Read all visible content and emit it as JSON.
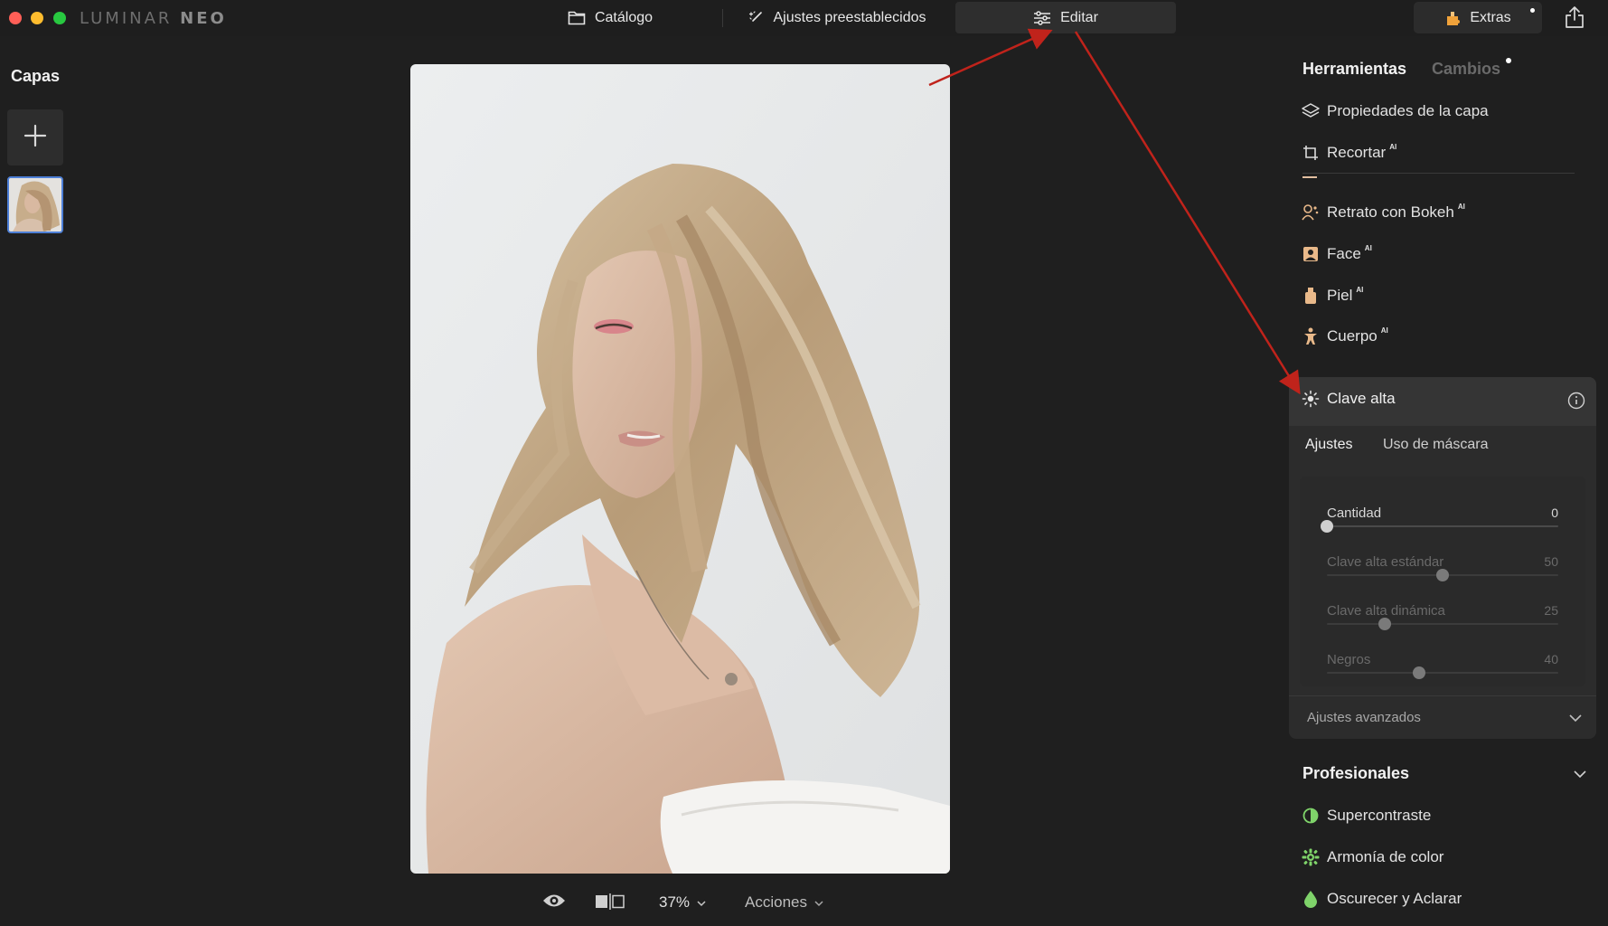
{
  "app": {
    "logo_main": "LUMINAR",
    "logo_sub": "NEO"
  },
  "topnav": {
    "catalog": "Catálogo",
    "presets": "Ajustes preestablecidos",
    "edit": "Editar",
    "extras": "Extras"
  },
  "left_panel": {
    "title": "Capas"
  },
  "bottom_bar": {
    "zoom": "37%",
    "actions": "Acciones"
  },
  "right_panel": {
    "tab_tools": "Herramientas",
    "tab_changes": "Cambios",
    "tools": [
      {
        "label": "Propiedades de la capa",
        "ai": ""
      },
      {
        "label": "Recortar",
        "ai": "AI"
      },
      {
        "label": "Retrato con Bokeh",
        "ai": "AI"
      },
      {
        "label": "Face",
        "ai": "AI"
      },
      {
        "label": "Piel",
        "ai": "AI"
      },
      {
        "label": "Cuerpo",
        "ai": "AI"
      }
    ],
    "card": {
      "title": "Clave alta",
      "tab_settings": "Ajustes",
      "tab_mask": "Uso de máscara",
      "sliders": [
        {
          "label": "Cantidad",
          "value": "0",
          "fraction": 0.0
        },
        {
          "label": "Clave alta estándar",
          "value": "50",
          "fraction": 0.5
        },
        {
          "label": "Clave alta dinámica",
          "value": "25",
          "fraction": 0.25
        },
        {
          "label": "Negros",
          "value": "40",
          "fraction": 0.4
        }
      ],
      "advanced": "Ajustes avanzados"
    },
    "professional": {
      "title": "Profesionales",
      "items": [
        {
          "label": "Supercontraste"
        },
        {
          "label": "Armonía de color"
        },
        {
          "label": "Oscurecer y Aclarar"
        }
      ]
    }
  },
  "colors": {
    "accent_arrow": "#c0231b",
    "icon_pro": "#7fd36a",
    "icon_portrait": "#e9b98a"
  }
}
